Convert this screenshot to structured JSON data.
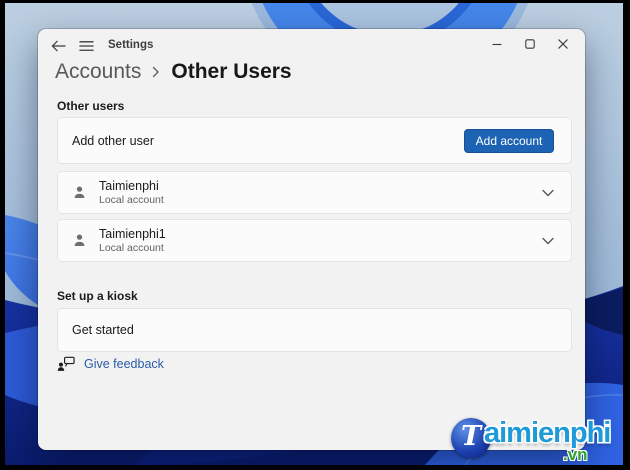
{
  "titlebar": {
    "title": "Settings"
  },
  "breadcrumb": {
    "parent": "Accounts",
    "current": "Other Users"
  },
  "page": {
    "other_users_label": "Other users",
    "add_row": {
      "label": "Add other user",
      "button_label": "Add account"
    },
    "users": [
      {
        "name": "Taimienphi",
        "account_type": "Local account"
      },
      {
        "name": "Taimienphi1",
        "account_type": "Local account"
      }
    ],
    "kiosk_label": "Set up a kiosk",
    "kiosk_row_label": "Get started",
    "feedback_label": "Give feedback"
  },
  "watermark": {
    "initial": "T",
    "name": "aimienphi",
    "domain": ".vn"
  },
  "colors": {
    "accent_button": "#1d63b4",
    "link": "#2b5ca8",
    "watermark_blue": "#1e9ad8",
    "watermark_green": "#2fa62f"
  }
}
